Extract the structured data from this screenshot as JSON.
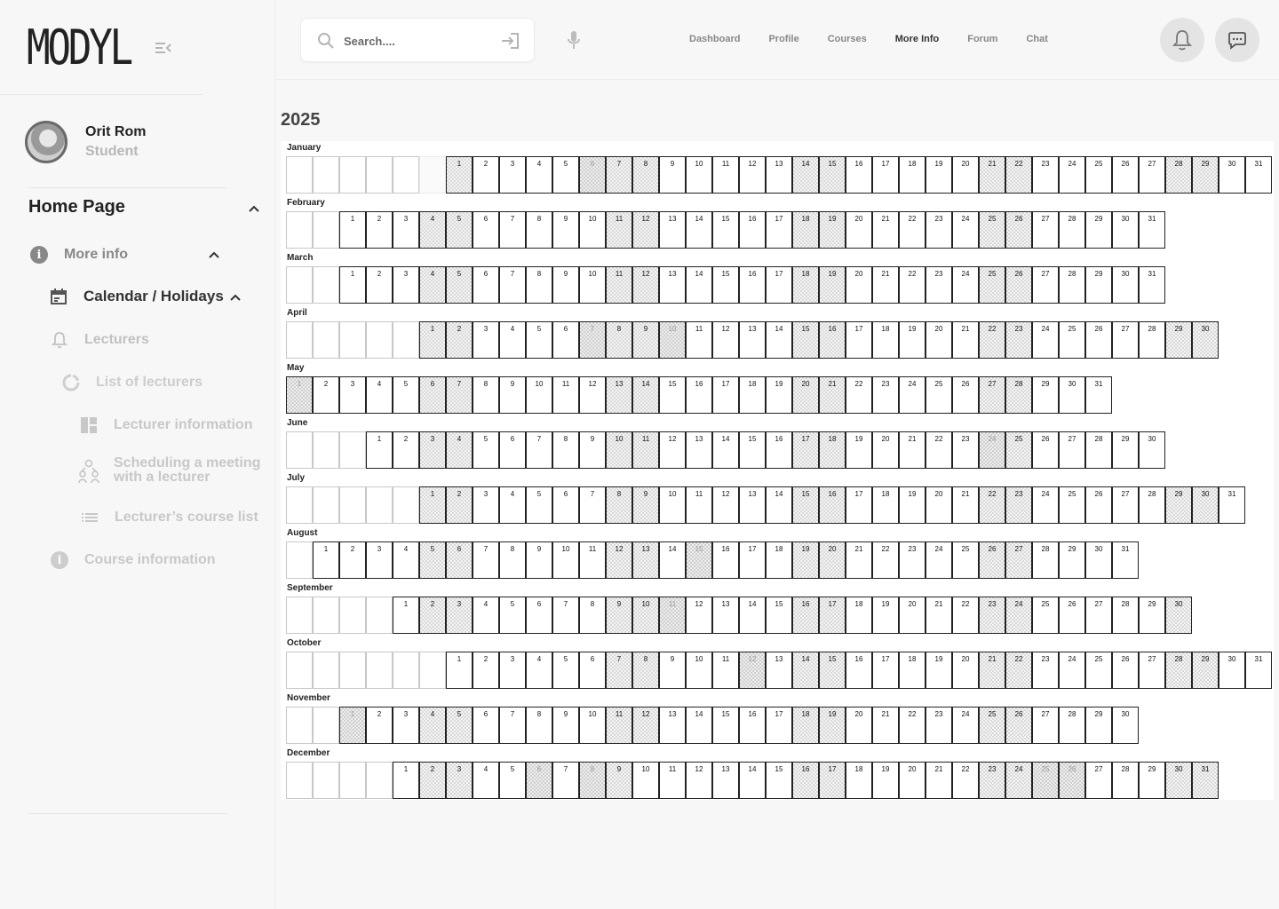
{
  "logo": "MODYL",
  "profile": {
    "name": "Orit Rom",
    "role": "Student"
  },
  "sidebar": {
    "home": "Home Page",
    "more_info": "More info",
    "calendar": "Calendar / Holidays",
    "lecturers": "Lecturers",
    "list_of_lecturers": "List of lecturers",
    "lecturer_information": "Lecturer information",
    "scheduling": "Scheduling a meeting with a lecturer",
    "course_list": "Lecturer’s course list",
    "course_information": "Course information"
  },
  "search": {
    "placeholder": "Search...."
  },
  "topnav": {
    "items": [
      "Dashboard",
      "Profile",
      "Courses",
      "More Info",
      "Forum",
      "Chat"
    ],
    "active": "More Info"
  },
  "calendar": {
    "year": "2025",
    "months": [
      {
        "name": "January",
        "offset": 6,
        "days": 31,
        "weekends": [
          1,
          6,
          7,
          8,
          14,
          15,
          21,
          22,
          28,
          29
        ],
        "holidays": [
          6
        ]
      },
      {
        "name": "February",
        "offset": 2,
        "days": 31,
        "weekends": [
          4,
          5,
          11,
          12,
          18,
          19,
          25,
          26
        ],
        "holidays": []
      },
      {
        "name": "March",
        "offset": 2,
        "days": 31,
        "weekends": [
          4,
          5,
          11,
          12,
          18,
          19,
          25,
          26
        ],
        "holidays": []
      },
      {
        "name": "April",
        "offset": 5,
        "days": 30,
        "weekends": [
          1,
          2,
          7,
          8,
          9,
          10,
          15,
          16,
          22,
          23,
          29,
          30
        ],
        "holidays": [
          7,
          10
        ]
      },
      {
        "name": "May",
        "offset": 0,
        "days": 31,
        "weekends": [
          1,
          6,
          7,
          13,
          14,
          20,
          21,
          27,
          28
        ],
        "holidays": [
          1
        ]
      },
      {
        "name": "June",
        "offset": 3,
        "days": 30,
        "weekends": [
          3,
          4,
          10,
          11,
          17,
          18,
          24,
          25
        ],
        "holidays": [
          24
        ]
      },
      {
        "name": "July",
        "offset": 5,
        "days": 31,
        "weekends": [
          1,
          2,
          8,
          9,
          15,
          16,
          22,
          23,
          29,
          30
        ],
        "holidays": []
      },
      {
        "name": "August",
        "offset": 1,
        "days": 31,
        "weekends": [
          5,
          6,
          12,
          13,
          15,
          19,
          20,
          26,
          27
        ],
        "holidays": [
          15
        ]
      },
      {
        "name": "September",
        "offset": 4,
        "days": 30,
        "weekends": [
          2,
          3,
          9,
          10,
          11,
          16,
          17,
          23,
          24,
          30
        ],
        "holidays": [
          11
        ]
      },
      {
        "name": "October",
        "offset": 6,
        "days": 31,
        "weekends": [
          7,
          8,
          12,
          14,
          15,
          21,
          22,
          28,
          29
        ],
        "holidays": [
          12
        ]
      },
      {
        "name": "November",
        "offset": 2,
        "days": 30,
        "weekends": [
          1,
          4,
          5,
          11,
          12,
          18,
          19,
          25,
          26
        ],
        "holidays": [
          1
        ]
      },
      {
        "name": "December",
        "offset": 4,
        "days": 31,
        "weekends": [
          2,
          3,
          6,
          8,
          9,
          16,
          17,
          23,
          24,
          25,
          26,
          30,
          31
        ],
        "holidays": [
          6,
          8,
          25,
          26
        ]
      }
    ]
  }
}
